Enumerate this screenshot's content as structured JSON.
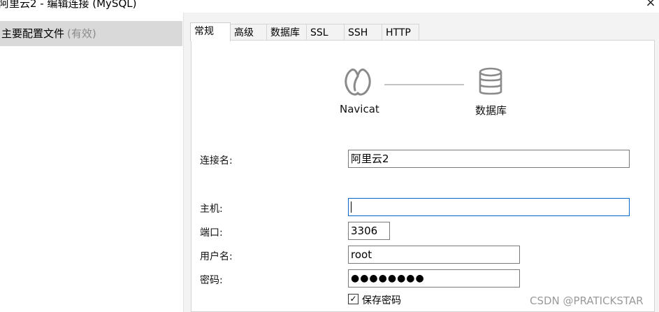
{
  "window": {
    "title": "阿里云2 - 编辑连接 (MySQL)",
    "close": "×"
  },
  "sidebar": {
    "items": [
      {
        "label": "主要配置文件",
        "sub": "(有效)"
      }
    ]
  },
  "tabs": [
    {
      "label": "常规"
    },
    {
      "label": "高级"
    },
    {
      "label": "数据库"
    },
    {
      "label": "SSL"
    },
    {
      "label": "SSH"
    },
    {
      "label": "HTTP"
    }
  ],
  "diagram": {
    "left": "Navicat",
    "right": "数据库"
  },
  "form": {
    "connection_name": {
      "label": "连接名:",
      "value": "阿里云2"
    },
    "host": {
      "label": "主机:",
      "value": ""
    },
    "port": {
      "label": "端口:",
      "value": "3306"
    },
    "username": {
      "label": "用户名:",
      "value": "root"
    },
    "password": {
      "label": "密码:",
      "value": "●●●●●●●●"
    },
    "save_password": {
      "label": "保存密码",
      "checked": true
    }
  },
  "watermark": "CSDN @PRATICKSTAR"
}
